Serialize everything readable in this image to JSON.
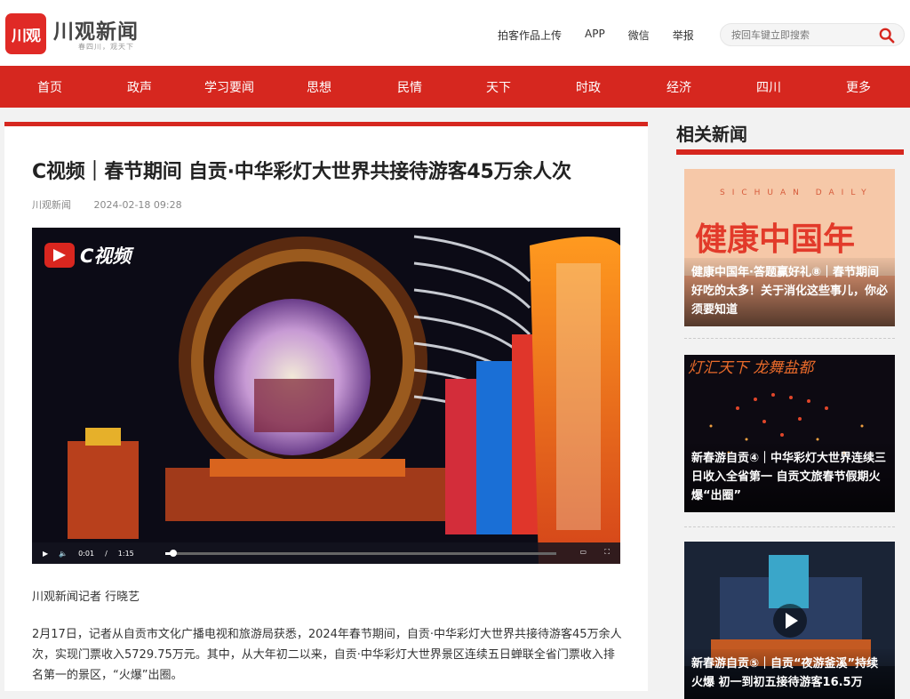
{
  "header": {
    "logo_text": "川观",
    "brand": "川观新闻",
    "slogan": "春四川，观天下",
    "links": [
      "拍客作品上传",
      "APP",
      "微信",
      "举报"
    ],
    "search_placeholder": "按回车键立即搜索"
  },
  "nav": [
    "首页",
    "政声",
    "学习要闻",
    "思想",
    "民情",
    "天下",
    "时政",
    "经济",
    "四川",
    "更多"
  ],
  "article": {
    "title": "C视频｜春节期间 自贡·中华彩灯大世界共接待游客45万余人次",
    "source": "川观新闻",
    "date": "2024-02-18 09:28",
    "video": {
      "badge": "C视频",
      "current_time": "0:01",
      "separator": "/",
      "duration": "1:15",
      "progress": 0.02
    },
    "byline": "川观新闻记者 行晓艺",
    "paragraph": "2月17日，记者从自贡市文化广播电视和旅游局获悉，2024年春节期间，自贡·中华彩灯大世界共接待游客45万余人次，实现门票收入5729.75万元。其中，从大年初二以来，自贡·中华彩灯大世界景区连续五日蝉联全省门票收入排名第一的景区，“火爆”出圈。"
  },
  "sidebar": {
    "title": "相关新闻",
    "cards": [
      {
        "caption": "健康中国年·答题赢好礼⑧｜春节期间好吃的太多！关于消化这些事儿，你必须要知道",
        "banner": "健康中国年",
        "top_text": "SICHUAN DAILY"
      },
      {
        "caption": "新春游自贡④｜中华彩灯大世界连续三日收入全省第一 自贡文旅春节假期火爆“出圈”",
        "top_text": "灯汇天下 龙舞盐都"
      },
      {
        "caption": "新春游自贡⑤｜自贡“夜游釜溪”持续火爆 初一到初五接待游客16.5万"
      }
    ]
  },
  "colors": {
    "accent": "#d6271f",
    "background": "#f2f2f2"
  }
}
